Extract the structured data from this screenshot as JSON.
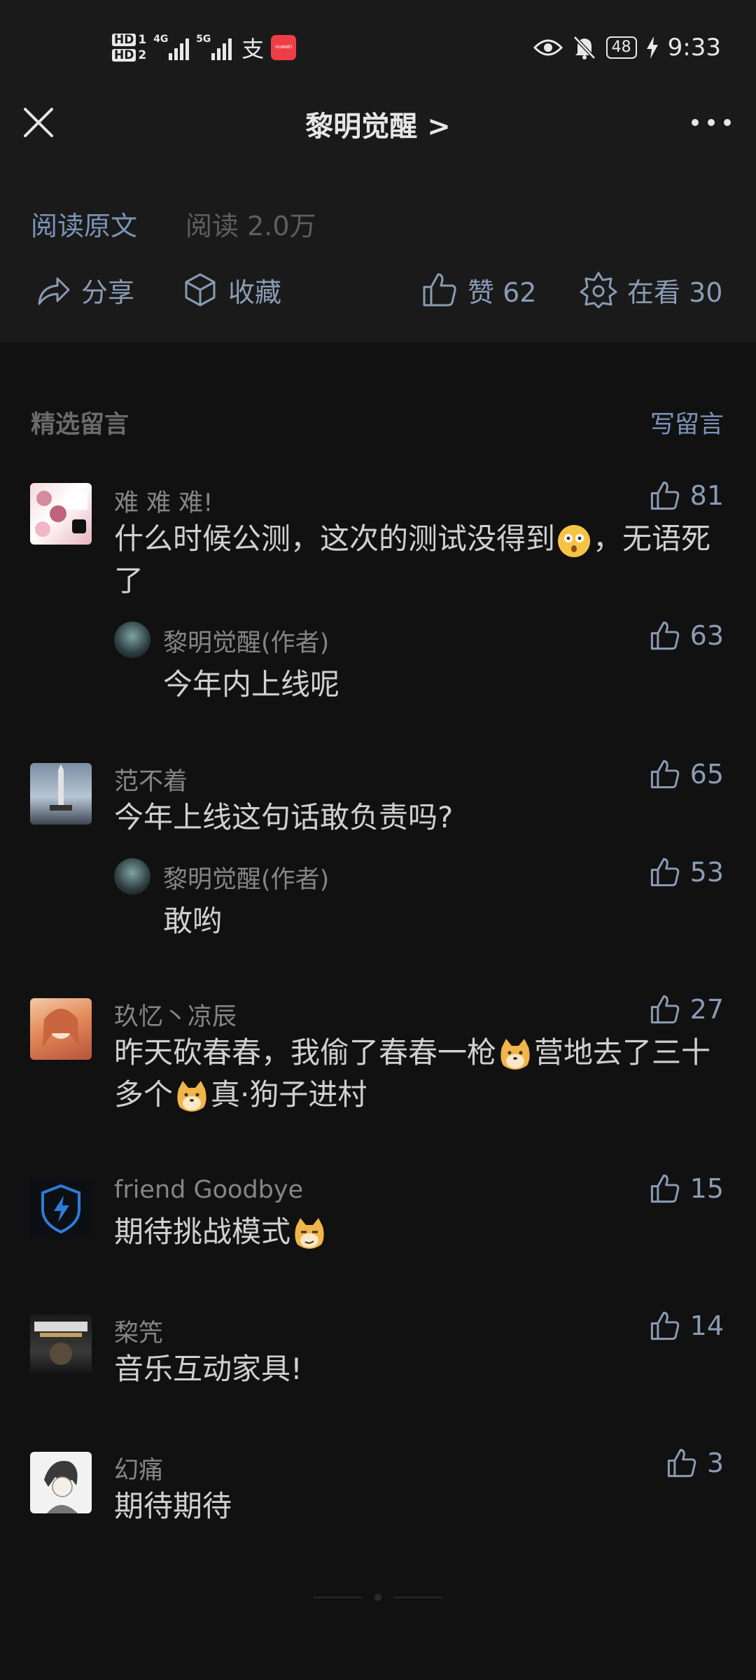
{
  "status_bar": {
    "hd1": "HD",
    "sim1": "1",
    "hd2": "HD",
    "sim2": "2",
    "net1": "4G",
    "net2": "5G",
    "alipay": "支",
    "huawei": "HUAWEI",
    "battery": "48",
    "time": "9:33"
  },
  "header": {
    "title": "黎明觉醒 >"
  },
  "meta": {
    "read_original": "阅读原文",
    "read_count": "阅读 2.0万"
  },
  "actions": {
    "share": "分享",
    "favorite": "收藏",
    "like": "赞 62",
    "watching": "在看 30"
  },
  "comments_section": {
    "title": "精选留言",
    "write": "写留言",
    "comments": [
      {
        "name": "难 难 难!",
        "text_a": "什么时候公测，这次的测试没得到",
        "text_b": "，无语死了",
        "likes": "81",
        "reply": {
          "name": "黎明觉醒(作者)",
          "text": "今年内上线呢",
          "likes": "63"
        }
      },
      {
        "name": "范不着",
        "text": "今年上线这句话敢负责吗?",
        "likes": "65",
        "reply": {
          "name": "黎明觉醒(作者)",
          "text": "敢哟",
          "likes": "53"
        }
      },
      {
        "name": "玖忆丶凉辰",
        "text_a": "昨天砍春春，我偷了春春一枪",
        "text_b": "营地去了三十多个",
        "text_c": "真·狗子进村",
        "likes": "27"
      },
      {
        "name": "friend Goodbye",
        "text": "期待挑战模式",
        "likes": "15"
      },
      {
        "name": "棃笐",
        "text": "音乐互动家具!",
        "likes": "14"
      },
      {
        "name": "幻痛",
        "text": "期待期待",
        "likes": "3"
      }
    ]
  },
  "colors": {
    "background": "#111111",
    "header_bg": "#1a1a1a",
    "accent": "#7a94b8"
  }
}
